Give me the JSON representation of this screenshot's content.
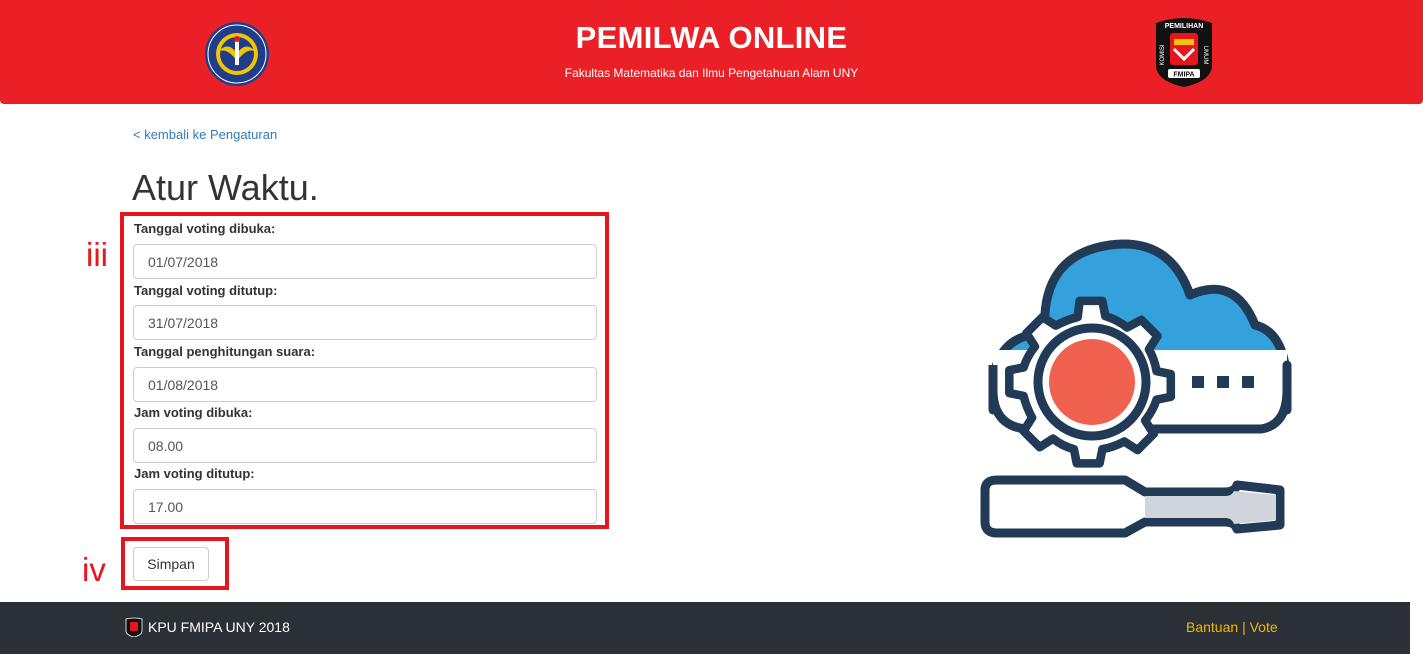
{
  "header": {
    "title": "PEMILWA ONLINE",
    "subtitle": "Fakultas Matematika dan Ilmu Pengetahuan Alam UNY",
    "left_logo": "university-logo",
    "right_logo": "kpu-logo",
    "right_logo_text": {
      "top": "PEMILIHAN",
      "left": "KOMISI",
      "right": "UMUM",
      "bottom": "FMIPA"
    },
    "background_color": "#eb2027"
  },
  "nav": {
    "back_link": "< kembali ke Pengaturan"
  },
  "page": {
    "title": "Atur Waktu."
  },
  "form": {
    "fields": [
      {
        "label": "Tanggal voting dibuka:",
        "value": "01/07/2018"
      },
      {
        "label": "Tanggal voting ditutup:",
        "value": "31/07/2018"
      },
      {
        "label": "Tanggal penghitungan suara:",
        "value": "01/08/2018"
      },
      {
        "label": "Jam voting dibuka:",
        "value": "08.00"
      },
      {
        "label": "Jam voting ditutup:",
        "value": "17.00"
      }
    ],
    "submit_label": "Simpan"
  },
  "annotations": {
    "fields_marker": "iii",
    "submit_marker": "iv",
    "color": "#e8141e"
  },
  "illustration": {
    "icon": "cloud-settings-wrench-icon",
    "colors": {
      "cloud": "#34a0dc",
      "gear_center": "#f0614f",
      "outline": "#213a55",
      "handle": "#d0d4db"
    }
  },
  "footer": {
    "logo": "kpu-logo",
    "text": "KPU FMIPA UNY 2018",
    "link_help": "Bantuan",
    "separator": "|",
    "link_vote": "Vote",
    "link_color": "#f2b705",
    "background_color": "#2b3036"
  }
}
